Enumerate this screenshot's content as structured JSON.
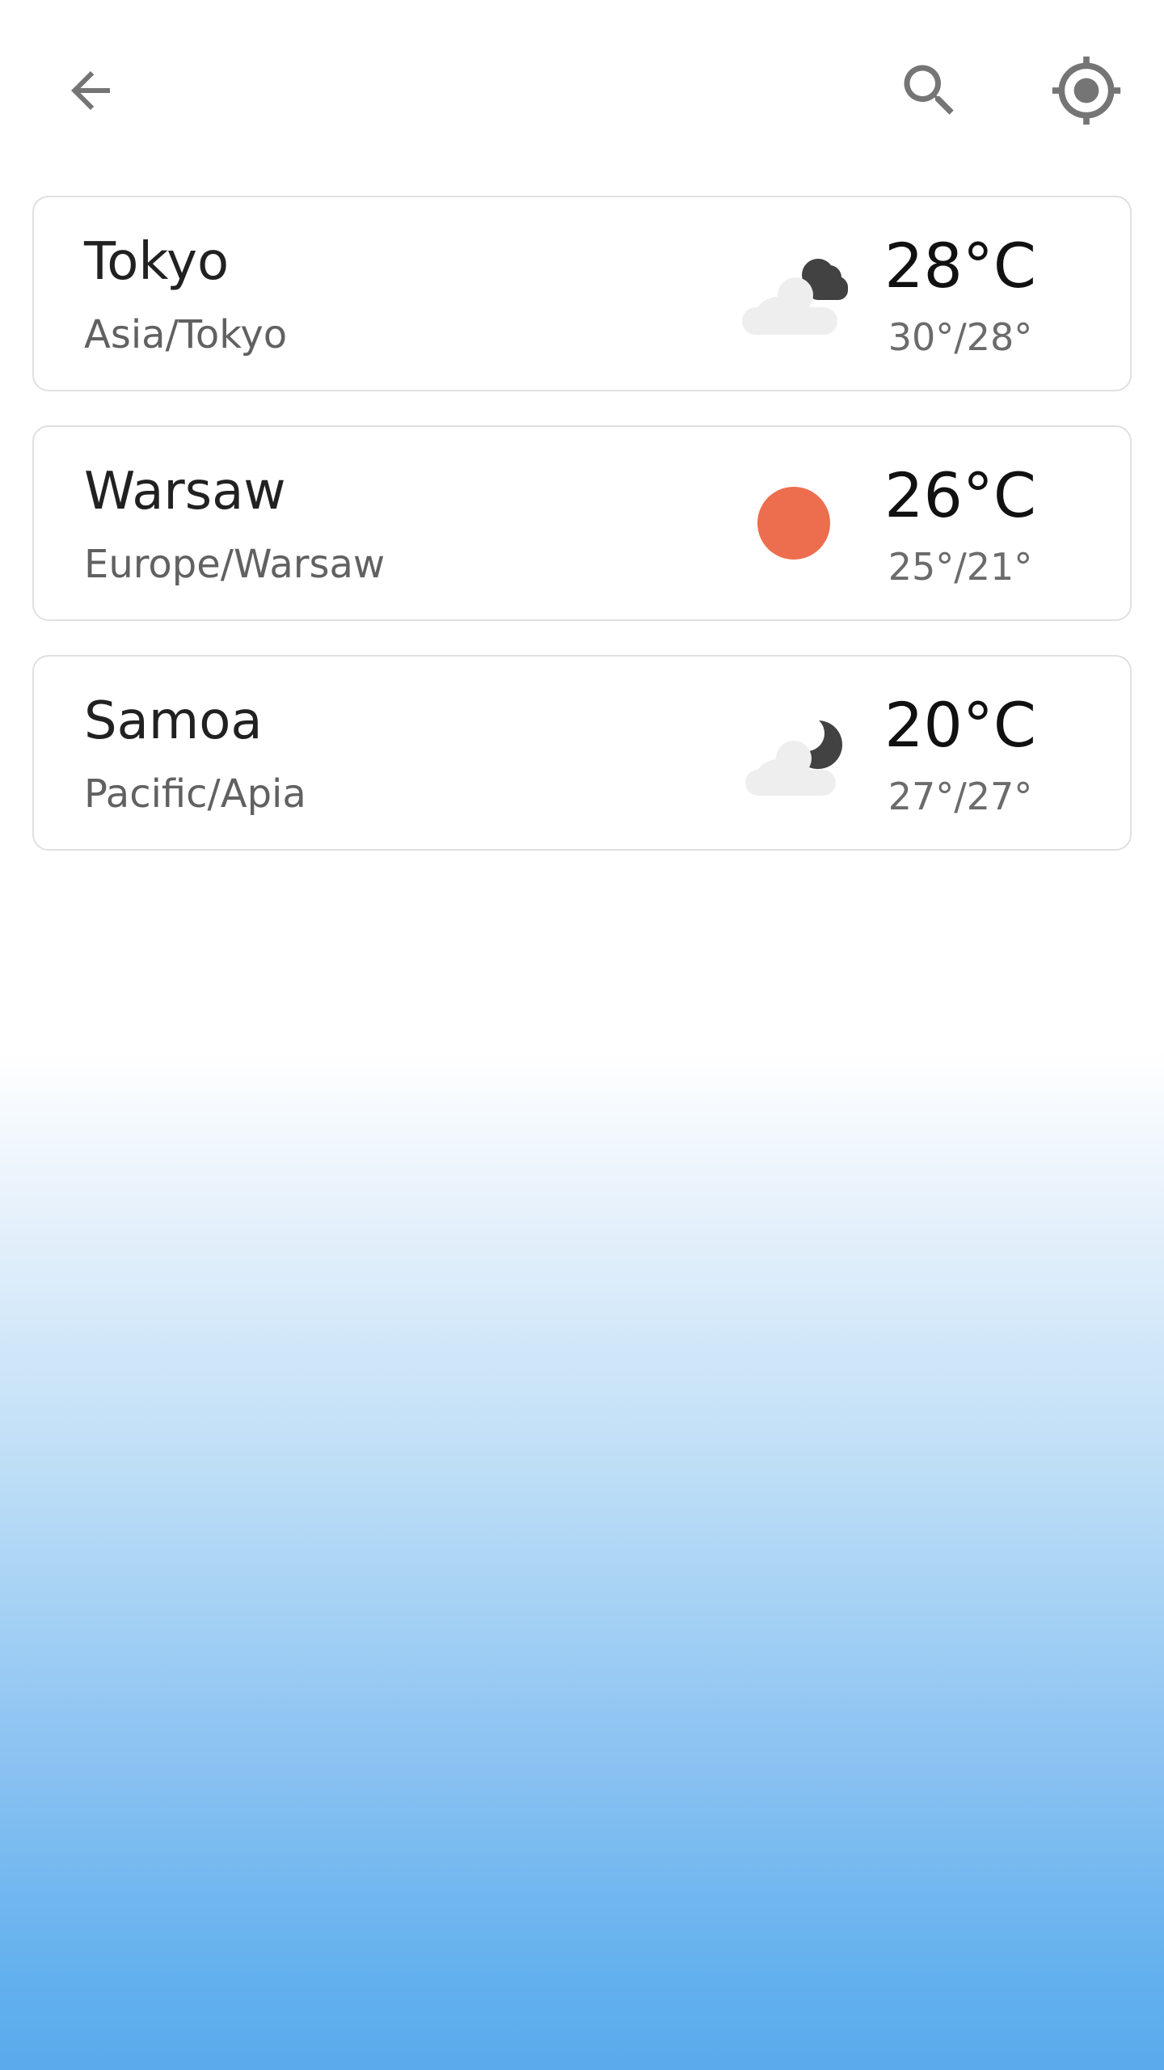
{
  "toolbar": {
    "back_icon": "arrow-left-icon",
    "search_icon": "search-icon",
    "location_icon": "my-location-icon",
    "icon_color": "#757575"
  },
  "locations": [
    {
      "city": "Tokyo",
      "timezone": "Asia/Tokyo",
      "temperature": "28°C",
      "range": "30°/28°",
      "icon": "cloudy-night-icon"
    },
    {
      "city": "Warsaw",
      "timezone": "Europe/Warsaw",
      "temperature": "26°C",
      "range": "25°/21°",
      "icon": "sun-icon"
    },
    {
      "city": "Samoa",
      "timezone": "Pacific/Apia",
      "temperature": "20°C",
      "range": "27°/27°",
      "icon": "partly-cloudy-night-icon"
    }
  ],
  "colors": {
    "sun": "#ed6e4e",
    "cloud_light": "#eeeeee",
    "cloud_dark": "#424242",
    "gradient_bottom": "#5aaaec"
  }
}
